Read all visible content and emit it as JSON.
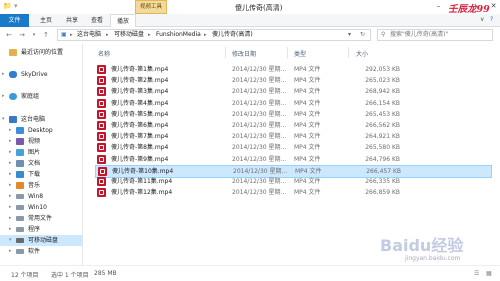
{
  "window": {
    "context_tab": "视频工具",
    "title": "傻儿传奇(高清)",
    "watermark_brand": "壬辰龙99",
    "minimize_icon": "minimize-icon",
    "close_icon": "close-icon"
  },
  "ribbon": {
    "tabs": [
      "文件",
      "主页",
      "共享",
      "查看",
      "播放"
    ],
    "help_glyph": "?"
  },
  "address": {
    "crumbs": [
      "这台电脑",
      "可移动磁盘",
      "FunshionMedia",
      "傻儿传奇(高清)"
    ],
    "search_placeholder": "搜索\"傻儿传奇(高清)\""
  },
  "sidebar": {
    "items": [
      {
        "label": "最近访问的位置",
        "icon": "recent-places-icon",
        "color": "#e4b24c"
      },
      {
        "label": "SkyDrive",
        "icon": "skydrive-icon",
        "color": "#2f7fd1"
      },
      {
        "label": "家庭组",
        "icon": "homegroup-icon",
        "color": "#3b9bd8"
      },
      {
        "label": "这台电脑",
        "icon": "computer-icon",
        "color": "#3a78c2"
      },
      {
        "label": "Desktop",
        "icon": "desktop-icon",
        "color": "#3e8fd8"
      },
      {
        "label": "视频",
        "icon": "video-folder-icon",
        "color": "#7a5ba8"
      },
      {
        "label": "图片",
        "icon": "pictures-folder-icon",
        "color": "#4aa0d8"
      },
      {
        "label": "文档",
        "icon": "documents-folder-icon",
        "color": "#6e8fb2"
      },
      {
        "label": "下载",
        "icon": "downloads-folder-icon",
        "color": "#3a8ad0"
      },
      {
        "label": "音乐",
        "icon": "music-folder-icon",
        "color": "#e08a2c"
      },
      {
        "label": "Win8",
        "icon": "drive-icon",
        "color": "#8a98a8"
      },
      {
        "label": "Win10",
        "icon": "drive-icon",
        "color": "#8a98a8"
      },
      {
        "label": "常用文件",
        "icon": "drive-icon",
        "color": "#8a98a8"
      },
      {
        "label": "程序",
        "icon": "drive-icon",
        "color": "#8a98a8"
      },
      {
        "label": "可移动磁盘",
        "icon": "removable-drive-icon",
        "color": "#6a6a6a"
      },
      {
        "label": "软件",
        "icon": "drive-icon",
        "color": "#8a98a8"
      }
    ]
  },
  "columns": {
    "name": "名称",
    "date": "修改日期",
    "type": "类型",
    "size": "大小"
  },
  "files": [
    {
      "name": "傻儿传奇-第1集.mp4",
      "date": "2014/12/30 星期...",
      "type": "MP4 文件",
      "size": "292,053 KB"
    },
    {
      "name": "傻儿传奇-第2集.mp4",
      "date": "2014/12/30 星期...",
      "type": "MP4 文件",
      "size": "265,023 KB"
    },
    {
      "name": "傻儿传奇-第3集.mp4",
      "date": "2014/12/30 星期...",
      "type": "MP4 文件",
      "size": "268,942 KB"
    },
    {
      "name": "傻儿传奇-第4集.mp4",
      "date": "2014/12/30 星期...",
      "type": "MP4 文件",
      "size": "266,154 KB"
    },
    {
      "name": "傻儿传奇-第5集.mp4",
      "date": "2014/12/30 星期...",
      "type": "MP4 文件",
      "size": "265,453 KB"
    },
    {
      "name": "傻儿传奇-第6集.mp4",
      "date": "2014/12/30 星期...",
      "type": "MP4 文件",
      "size": "266,562 KB"
    },
    {
      "name": "傻儿传奇-第7集.mp4",
      "date": "2014/12/30 星期...",
      "type": "MP4 文件",
      "size": "264,921 KB"
    },
    {
      "name": "傻儿传奇-第8集.mp4",
      "date": "2014/12/30 星期...",
      "type": "MP4 文件",
      "size": "265,580 KB"
    },
    {
      "name": "傻儿传奇-第9集.mp4",
      "date": "2014/12/30 星期...",
      "type": "MP4 文件",
      "size": "264,796 KB"
    },
    {
      "name": "傻儿传奇-第10集.mp4",
      "date": "2014/12/30 星期...",
      "type": "MP4 文件",
      "size": "266,457 KB",
      "selected": true
    },
    {
      "name": "傻儿传奇-第11集.mp4",
      "date": "2014/12/30 星期...",
      "type": "MP4 文件",
      "size": "266,335 KB"
    },
    {
      "name": "傻儿传奇-第12集.mp4",
      "date": "2014/12/30 星期...",
      "type": "MP4 文件",
      "size": "266,859 KB"
    }
  ],
  "status": {
    "item_count": "12 个项目",
    "selected": "选中 1 个项目",
    "selected_size": "285 MB"
  },
  "watermark": {
    "site": "Baidu经验",
    "url": "jingyan.baidu.com"
  },
  "colors": {
    "file_tab": "#1979ca",
    "selection": "#cce8ff",
    "context_tab": "#f3d99a",
    "mp4_icon": "#c3162a"
  }
}
